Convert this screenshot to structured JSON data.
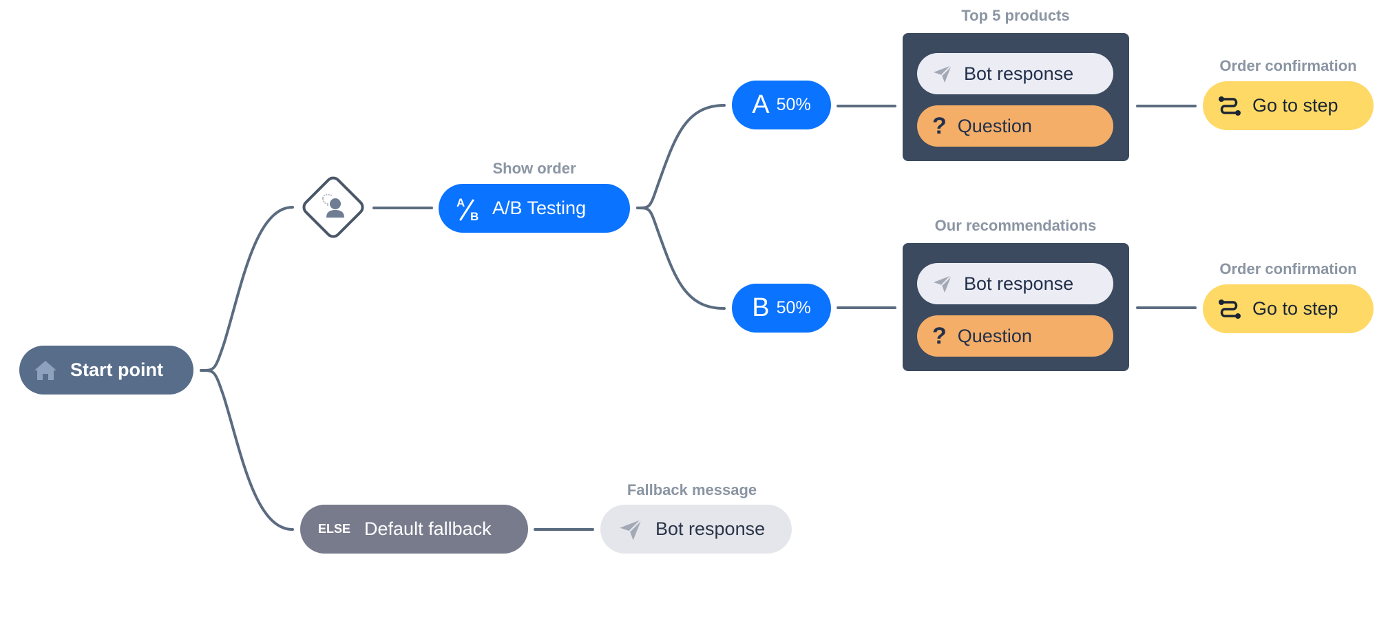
{
  "colors": {
    "wire": "#5b6b80",
    "start": "#576d8a",
    "ab_blue": "#0a73ff",
    "group_bg": "#3b4a5f",
    "bot_response_bg": "#ebecf4",
    "question_bg": "#f4ae68",
    "goto_bg": "#ffd966",
    "fallback_bg": "#787b8c",
    "fallback_bot_bg": "#e4e6eb",
    "caption": "#8b95a3"
  },
  "start": {
    "icon": "home-icon",
    "label": "Start point"
  },
  "condition": {
    "icon": "user-chat-icon"
  },
  "ab_test": {
    "caption": "Show order",
    "icon": "ab-icon",
    "label": "A/B Testing"
  },
  "variants": [
    {
      "letter": "A",
      "percent": "50%",
      "group": {
        "caption": "Top 5 products",
        "items": [
          {
            "icon": "paper-plane-icon",
            "label": "Bot response"
          },
          {
            "icon": "question-icon",
            "label": "Question"
          }
        ]
      },
      "goto": {
        "caption": "Order confirmation",
        "icon": "route-icon",
        "label": "Go to step"
      }
    },
    {
      "letter": "B",
      "percent": "50%",
      "group": {
        "caption": "Our recommendations",
        "items": [
          {
            "icon": "paper-plane-icon",
            "label": "Bot response"
          },
          {
            "icon": "question-icon",
            "label": "Question"
          }
        ]
      },
      "goto": {
        "caption": "Order confirmation",
        "icon": "route-icon",
        "label": "Go to step"
      }
    }
  ],
  "fallback": {
    "tag": "ELSE",
    "label": "Default fallback",
    "response": {
      "caption": "Fallback message",
      "icon": "paper-plane-icon",
      "label": "Bot response"
    }
  }
}
